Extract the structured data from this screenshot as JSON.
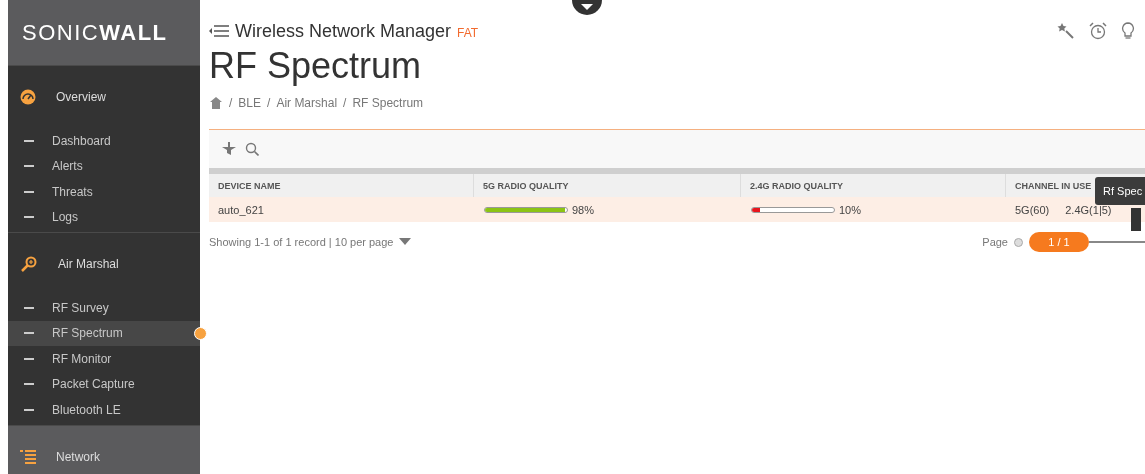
{
  "brand": {
    "logo_light": "SONIC",
    "logo_bold": "WALL"
  },
  "sidebar": {
    "sections": [
      {
        "label": "Overview",
        "items": [
          {
            "label": "Dashboard",
            "selected": false
          },
          {
            "label": "Alerts",
            "selected": false
          },
          {
            "label": "Threats",
            "selected": false
          },
          {
            "label": "Logs",
            "selected": false
          }
        ]
      },
      {
        "label": "Air Marshal",
        "items": [
          {
            "label": "RF Survey",
            "selected": false
          },
          {
            "label": "RF Spectrum",
            "selected": true
          },
          {
            "label": "RF Monitor",
            "selected": false
          },
          {
            "label": "Packet Capture",
            "selected": false
          },
          {
            "label": "Bluetooth LE",
            "selected": false
          }
        ]
      },
      {
        "label": "Network"
      }
    ]
  },
  "header": {
    "title": "Wireless Network Manager",
    "badge": "FAT"
  },
  "page_title": "RF Spectrum",
  "breadcrumb": {
    "separator": "/",
    "items": [
      "BLE",
      "Air Marshal",
      "RF Spectrum"
    ]
  },
  "table": {
    "columns": [
      "DEVICE NAME",
      "5G RADIO QUALITY",
      "2.4G RADIO QUALITY",
      "CHANNEL IN USE"
    ],
    "rows": [
      {
        "device": "auto_621",
        "quality_5g": {
          "level": 0.98,
          "reading": "98%",
          "color": "#8cc414"
        },
        "quality_24g": {
          "level": 0.1,
          "reading": "10%",
          "color": "#e8141c"
        },
        "channels": [
          "5G(60)",
          "2.4G(1|5)"
        ]
      }
    ]
  },
  "footer": {
    "showing": "Showing 1-1 of 1 record | 10 per page",
    "page_label": "Page",
    "page": "1 / 1"
  },
  "tooltip": "Rf Spec"
}
